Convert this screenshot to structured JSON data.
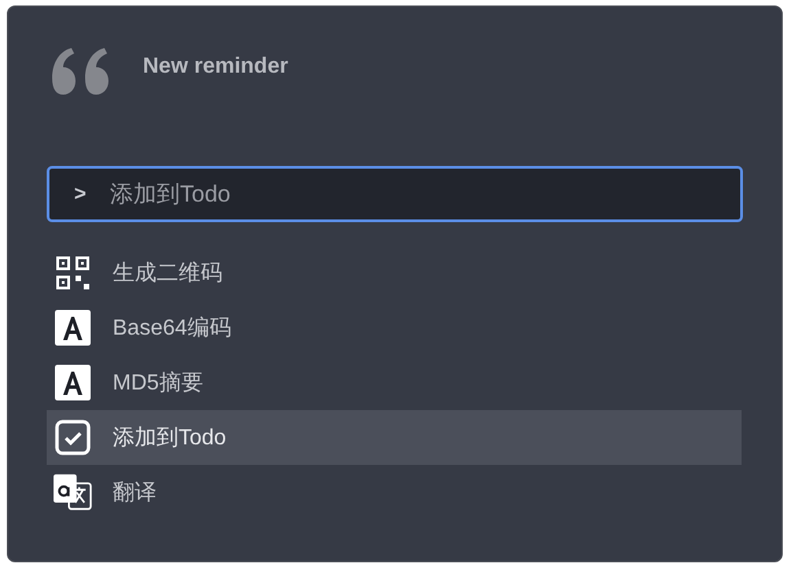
{
  "header": {
    "title": "New reminder"
  },
  "search": {
    "value": "添加到Todo",
    "prompt": ">"
  },
  "items": [
    {
      "label": "生成二维码",
      "kind": "qr",
      "selected": false
    },
    {
      "label": "Base64编码",
      "kind": "letter",
      "selected": false
    },
    {
      "label": "MD5摘要",
      "kind": "letter",
      "selected": false
    },
    {
      "label": "添加到Todo",
      "kind": "check",
      "selected": true
    },
    {
      "label": "翻译",
      "kind": "translate",
      "selected": false
    }
  ]
}
